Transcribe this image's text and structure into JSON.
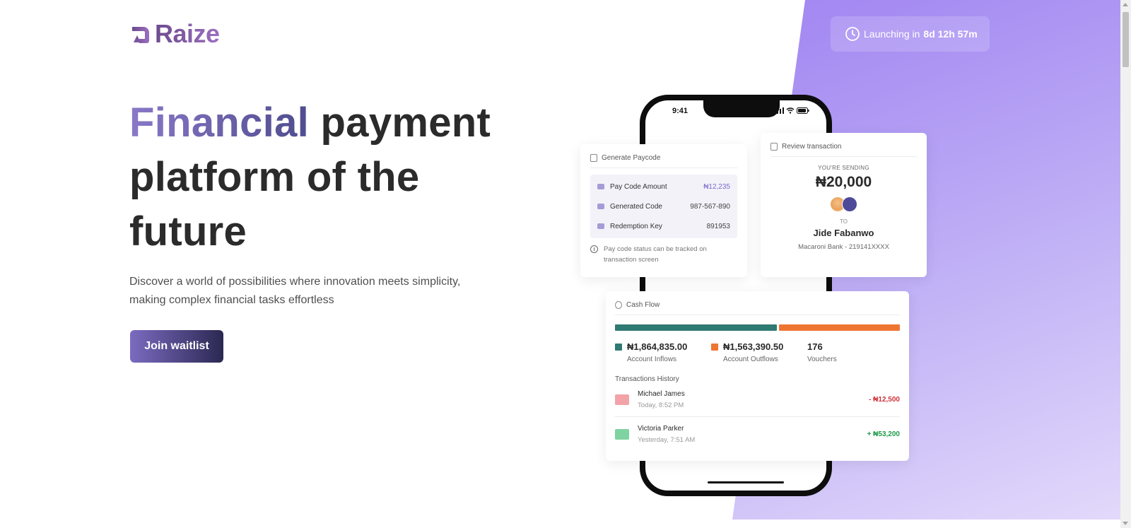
{
  "brand": {
    "name": "Raize"
  },
  "launch": {
    "prefix": "Launching in",
    "countdown": "8d 12h 57m"
  },
  "hero": {
    "title_accent": "Financial",
    "title_rest": "payment platform of the future",
    "subtitle": "Discover a world of possibilities where innovation meets simplicity, making complex financial tasks effortless",
    "cta": "Join waitlist"
  },
  "phone": {
    "time": "9:41"
  },
  "paycode_card": {
    "title": "Generate Paycode",
    "rows": [
      {
        "label": "Pay Code Amount",
        "value": "₦12,235",
        "icon": "money-icon"
      },
      {
        "label": "Generated Code",
        "value": "987-567-890",
        "icon": "ticket-icon"
      },
      {
        "label": "Redemption Key",
        "value": "891953",
        "icon": "key-icon"
      }
    ],
    "note": "Pay code status can be tracked on transaction screen"
  },
  "review_card": {
    "title": "Review transaction",
    "sending_label": "YOU'RE SENDING",
    "amount": "₦20,000",
    "to_label": "TO",
    "recipient": "Jide Fabanwo",
    "bank": "Macaroni Bank - 219141XXXX"
  },
  "cash_card": {
    "title": "Cash Flow",
    "inflows": {
      "value": "₦1,864,835.00",
      "label": "Account Inflows",
      "color": "#2f7a72"
    },
    "outflows": {
      "value": "₦1,563,390.50",
      "label": "Account Outflows",
      "color": "#ef7632"
    },
    "vouchers": {
      "value": "176",
      "label": "Vouchers"
    },
    "history_title": "Transactions History",
    "transactions": [
      {
        "name": "Michael James",
        "time": "Today, 8:52 PM",
        "amount": "- ₦12,500",
        "color": "#d1323a",
        "icon_color": "#f3a3a8"
      },
      {
        "name": "Victoria Parker",
        "time": "Yesterday, 7:51 AM",
        "amount": "+ ₦53,200",
        "color": "#1f9a4a",
        "icon_color": "#7fd3a0"
      }
    ]
  }
}
